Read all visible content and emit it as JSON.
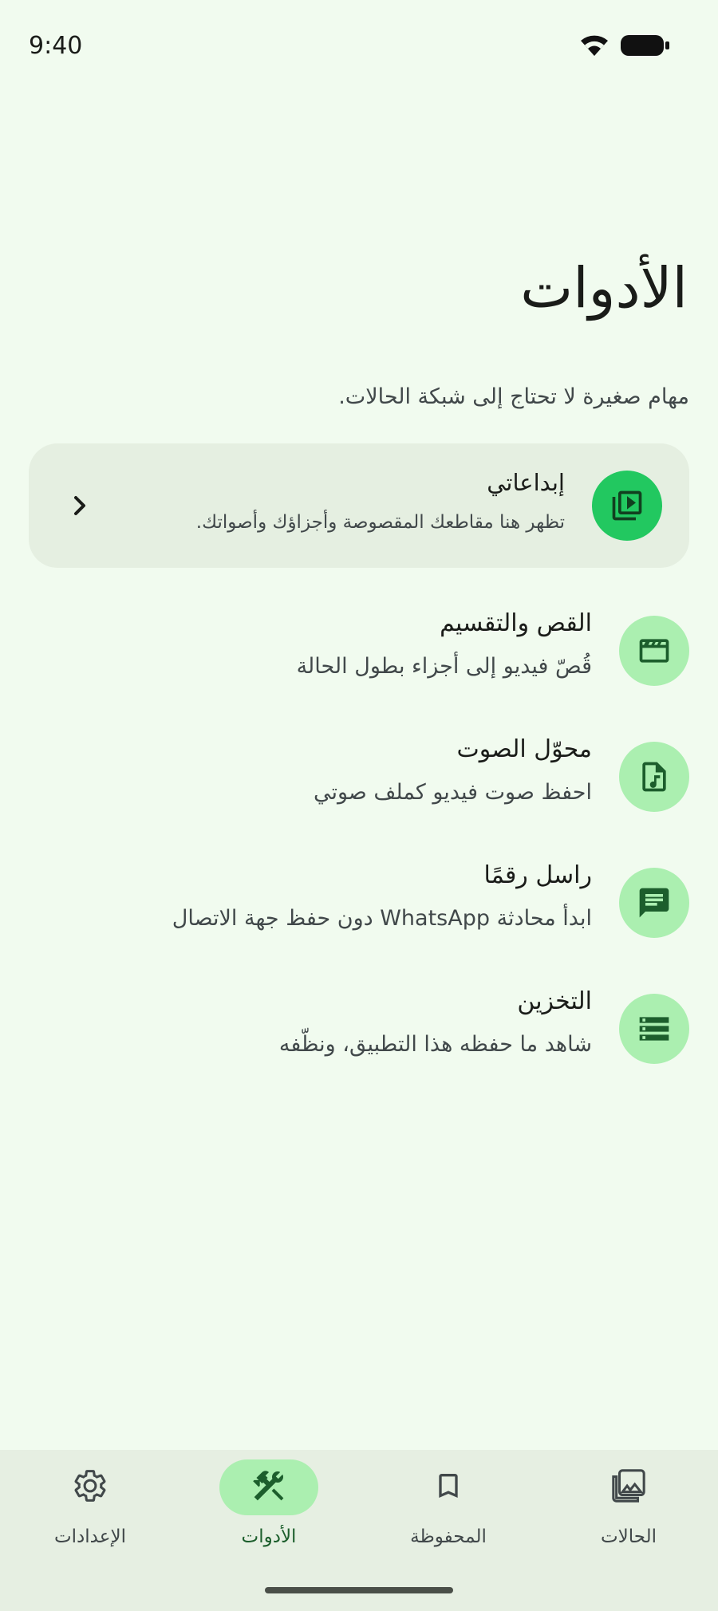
{
  "status_bar": {
    "time": "9:40",
    "icons": [
      "wifi-icon",
      "battery-icon"
    ]
  },
  "header": {
    "title": "الأدوات",
    "subtitle": "مهام صغيرة لا تحتاج إلى شبكة الحالات."
  },
  "featured": {
    "title": "إبداعاتي",
    "description": "تظهر هنا مقاطعك المقصوصة وأجزاؤك وأصواتك.",
    "icon": "video-library-icon",
    "accent": "#22c860"
  },
  "tools": [
    {
      "title": "القص والتقسيم",
      "description": "قُصّ فيديو إلى أجزاء بطول الحالة",
      "icon": "clapperboard-icon"
    },
    {
      "title": "محوّل الصوت",
      "description": "احفظ صوت فيديو كملف صوتي",
      "icon": "audio-file-icon"
    },
    {
      "title": "راسل رقمًا",
      "description": "ابدأ محادثة WhatsApp دون حفظ جهة الاتصال",
      "icon": "message-icon"
    },
    {
      "title": "التخزين",
      "description": "شاهد ما حفظه هذا التطبيق، ونظّفه",
      "icon": "storage-icon"
    }
  ],
  "bottom_nav": {
    "items": [
      {
        "label": "الحالات",
        "icon": "gallery-icon",
        "active": false
      },
      {
        "label": "المحفوظة",
        "icon": "bookmark-icon",
        "active": false
      },
      {
        "label": "الأدوات",
        "icon": "tools-icon",
        "active": true
      },
      {
        "label": "الإعدادات",
        "icon": "gear-icon",
        "active": false
      }
    ]
  },
  "colors": {
    "background": "#f1fbef",
    "card": "#e5efe1",
    "icon_bg": "#abefb0",
    "icon_fg": "#1c5e2c",
    "accent": "#22c860"
  }
}
